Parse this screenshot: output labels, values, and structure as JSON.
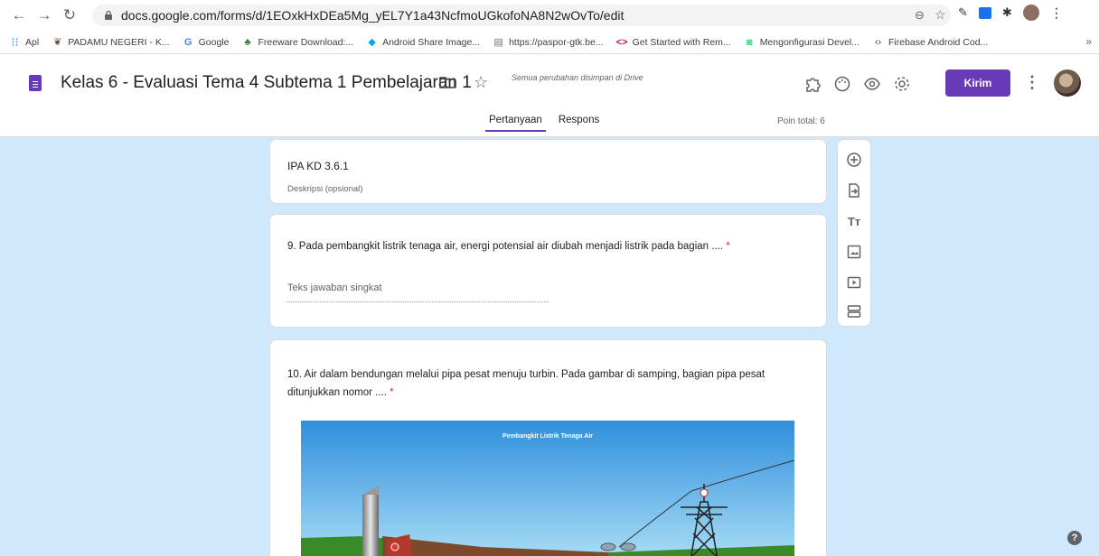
{
  "browser": {
    "url": "docs.google.com/forms/d/1EOxkHxDEa5Mg_yEL7Y1a43NcfmoUGkofoNA8N2wOvTo/edit"
  },
  "bookmarks": [
    {
      "label": "Apl",
      "icon": "apps-grid-icon"
    },
    {
      "label": "PADAMU NEGERI - K...",
      "icon": "emblem-icon"
    },
    {
      "label": "Google",
      "icon": "google-g-icon"
    },
    {
      "label": "Freeware Download:...",
      "icon": "palm-icon"
    },
    {
      "label": "Android Share Image...",
      "icon": "android-share-icon"
    },
    {
      "label": "https://paspor-gtk.be...",
      "icon": "page-icon"
    },
    {
      "label": "Get Started with Rem...",
      "icon": "code-icon"
    },
    {
      "label": "Mengonfigurasi Devel...",
      "icon": "android-icon"
    },
    {
      "label": "Firebase Android Cod...",
      "icon": "code-brackets-icon"
    }
  ],
  "form": {
    "title": "Kelas 6 - Evaluasi Tema 4 Subtema 1 Pembelajaran 1",
    "saved_status": "Semua perubahan disimpan di Drive",
    "send_label": "Kirim",
    "tabs": [
      "Pertanyaan",
      "Respons"
    ],
    "total_points": "Poin total: 6"
  },
  "section": {
    "title": "IPA KD 3.6.1",
    "description": "Deskripsi (opsional)"
  },
  "questions": [
    {
      "text": "9. Pada pembangkit listrik tenaga air, energi potensial air diubah menjadi listrik pada bagian ....",
      "required": "*",
      "answer_placeholder": "Teks jawaban singkat"
    },
    {
      "text": "10. Air dalam bendungan melalui pipa pesat menuju turbin. Pada gambar di samping, bagian pipa pesat ditunjukkan nomor ....",
      "required": "*",
      "image_title": "Pembangkit Listrik Tenaga Air"
    }
  ],
  "colors": {
    "accent": "#673ab7",
    "canvas": "#d0e8fb"
  }
}
